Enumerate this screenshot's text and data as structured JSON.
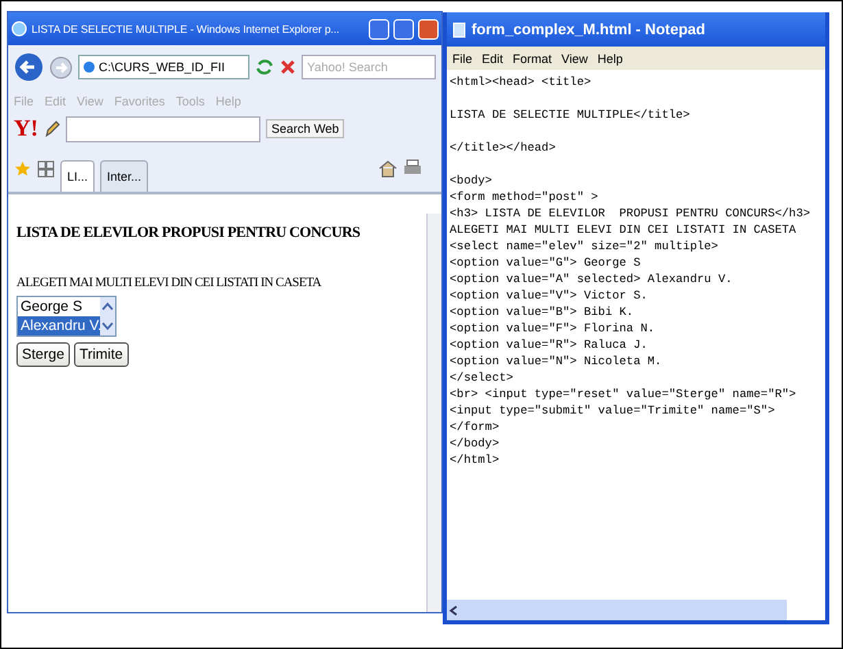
{
  "browser": {
    "title": "LISTA DE SELECTIE MULTIPLE - Windows Internet Explorer p...",
    "address": "C:\\CURS_WEB_ID_FII",
    "search_placeholder": "Yahoo! Search",
    "menu": [
      "File",
      "Edit",
      "View",
      "Favorites",
      "Tools",
      "Help"
    ],
    "yahoo_logo": "Y!",
    "search_web_button": "Search Web",
    "tabs": [
      {
        "label": "LI...",
        "selected": true
      },
      {
        "label": "Inter...",
        "selected": false
      }
    ],
    "page": {
      "heading": "LISTA DE ELEVILOR PROPUSI PENTRU CONCURS",
      "prompt": "ALEGETI MAI MULTI ELEVI DIN CEI LISTATI IN CASETA",
      "options": [
        {
          "label": "George S",
          "selected": false
        },
        {
          "label": "Alexandru V.",
          "selected": true
        }
      ],
      "buttons": [
        "Sterge",
        "Trimite"
      ]
    }
  },
  "notepad": {
    "title": "form_complex_M.html - Notepad",
    "menu": [
      "File",
      "Edit",
      "Format",
      "View",
      "Help"
    ],
    "paragraphs": [
      [
        "<html><head> <title>"
      ],
      [
        "LISTA DE SELECTIE MULTIPLE</title>"
      ],
      [
        "</title></head>"
      ],
      [
        "<body>",
        "<form method=\"post\" >",
        "<h3> LISTA DE ELEVILOR  PROPUSI PENTRU CONCURS</h3>",
        "ALEGETI MAI MULTI ELEVI DIN CEI LISTATI IN CASETA",
        "<select name=\"elev\" size=\"2\" multiple>",
        "<option value=\"G\"> George S",
        "<option value=\"A\" selected> Alexandru V.",
        "<option value=\"V\"> Victor S.",
        "<option value=\"B\"> Bibi K.",
        "<option value=\"F\"> Florina N.",
        "<option value=\"R\"> Raluca J.",
        "<option value=\"N\"> Nicoleta M.",
        "</select>",
        "<br> <input type=\"reset\" value=\"Sterge\" name=\"R\">",
        "<input type=\"submit\" value=\"Trimite\" name=\"S\">",
        "</form>",
        "</body>",
        "</html>"
      ]
    ]
  }
}
